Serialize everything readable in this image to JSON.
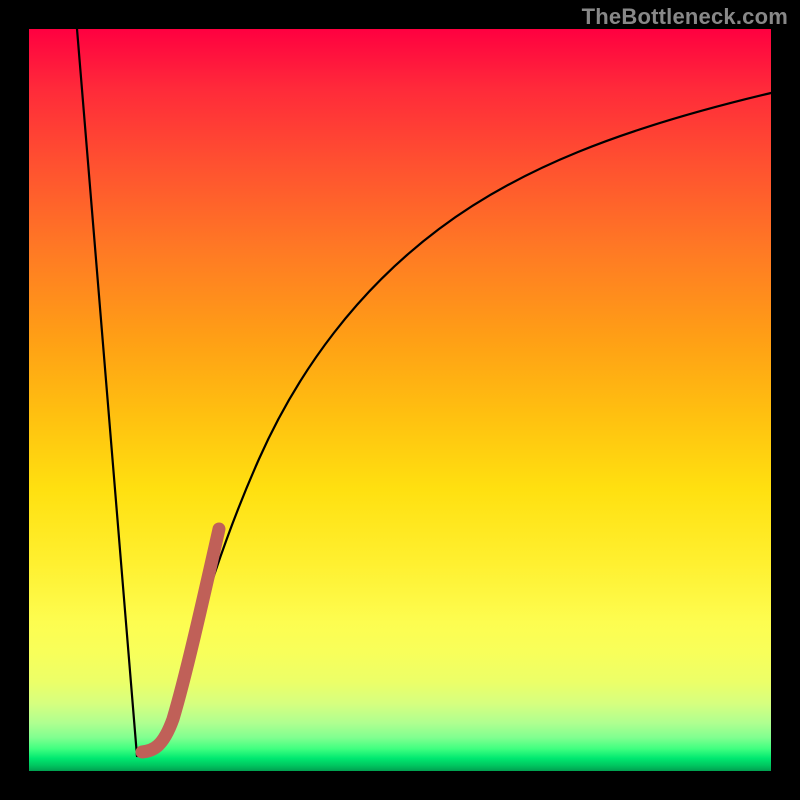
{
  "watermark": "TheBottleneck.com",
  "colors": {
    "frame": "#000000",
    "curve_black": "#000000",
    "highlight_stroke": "#c06058",
    "gradient_top": "#ff0040",
    "gradient_bottom": "#00a050"
  },
  "chart_data": {
    "type": "line",
    "title": "",
    "xlabel": "",
    "ylabel": "",
    "xlim": [
      0,
      100
    ],
    "ylim": [
      0,
      100
    ],
    "grid": false,
    "series": [
      {
        "name": "black-curve-left",
        "stroke": "curve_black",
        "points": [
          {
            "x": 6.5,
            "y": 100
          },
          {
            "x": 14.5,
            "y": 2
          }
        ]
      },
      {
        "name": "black-curve-right",
        "stroke": "curve_black",
        "points": [
          {
            "x": 14.5,
            "y": 2
          },
          {
            "x": 17,
            "y": 6
          },
          {
            "x": 20,
            "y": 20
          },
          {
            "x": 24,
            "y": 36
          },
          {
            "x": 30,
            "y": 52
          },
          {
            "x": 38,
            "y": 66
          },
          {
            "x": 48,
            "y": 76
          },
          {
            "x": 60,
            "y": 83
          },
          {
            "x": 75,
            "y": 88
          },
          {
            "x": 90,
            "y": 91
          },
          {
            "x": 100,
            "y": 92
          }
        ]
      },
      {
        "name": "highlight-segment",
        "stroke": "highlight_stroke",
        "points": [
          {
            "x": 15.5,
            "y": 2.5
          },
          {
            "x": 18,
            "y": 3
          },
          {
            "x": 20,
            "y": 10
          },
          {
            "x": 23,
            "y": 24
          },
          {
            "x": 25.5,
            "y": 34
          }
        ]
      }
    ]
  }
}
